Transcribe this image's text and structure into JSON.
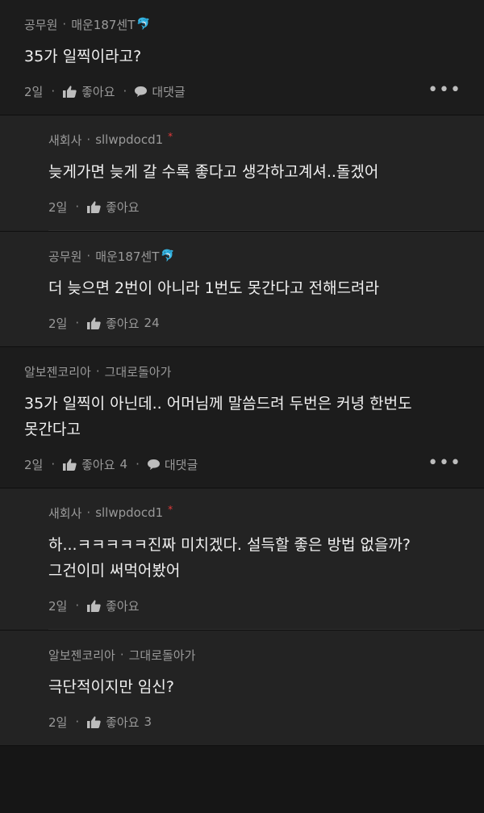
{
  "comments": [
    {
      "author": "공무원",
      "nickname": "매운187센T",
      "badge": "dolphin",
      "text": "35가 일찍이라고?",
      "date": "2일",
      "like_label": "좋아요",
      "like_count": "",
      "reply_label": "대댓글",
      "more_icon": "more-icon"
    },
    {
      "author": "새회사",
      "nickname": "sllwpdocd1",
      "badge": "star",
      "text": "늦게가면 늦게 갈 수록 좋다고 생각하고계셔..돌겠어",
      "date": "2일",
      "like_label": "좋아요",
      "like_count": ""
    },
    {
      "author": "공무원",
      "nickname": "매운187센T",
      "badge": "dolphin",
      "text": "더 늦으면 2번이 아니라 1번도 못간다고 전해드려라",
      "date": "2일",
      "like_label": "좋아요",
      "like_count": "24"
    },
    {
      "author": "알보젠코리아",
      "nickname": "그대로돌아가",
      "text": "35가 일찍이 아닌데.. 어머님께 말씀드려 두번은 커녕 한번도 못간다고",
      "date": "2일",
      "like_label": "좋아요",
      "like_count": "4",
      "reply_label": "대댓글",
      "more_icon": "more-icon"
    },
    {
      "author": "새회사",
      "nickname": "sllwpdocd1",
      "badge": "star",
      "text": "하...ㅋㅋㅋㅋㅋ진짜 미치겠다. 설득할 좋은 방법 없을까? 그건이미 써먹어봤어",
      "date": "2일",
      "like_label": "좋아요",
      "like_count": ""
    },
    {
      "author": "알보젠코리아",
      "nickname": "그대로돌아가",
      "text": "극단적이지만 임신?",
      "date": "2일",
      "like_label": "좋아요",
      "like_count": "3"
    }
  ],
  "colors": {
    "background": "#161616",
    "top_comment_bg": "#1c1c1c",
    "reply_bg": "#232323",
    "dolphin_badge": "#4aa3df",
    "star_badge": "#e23a3a"
  }
}
